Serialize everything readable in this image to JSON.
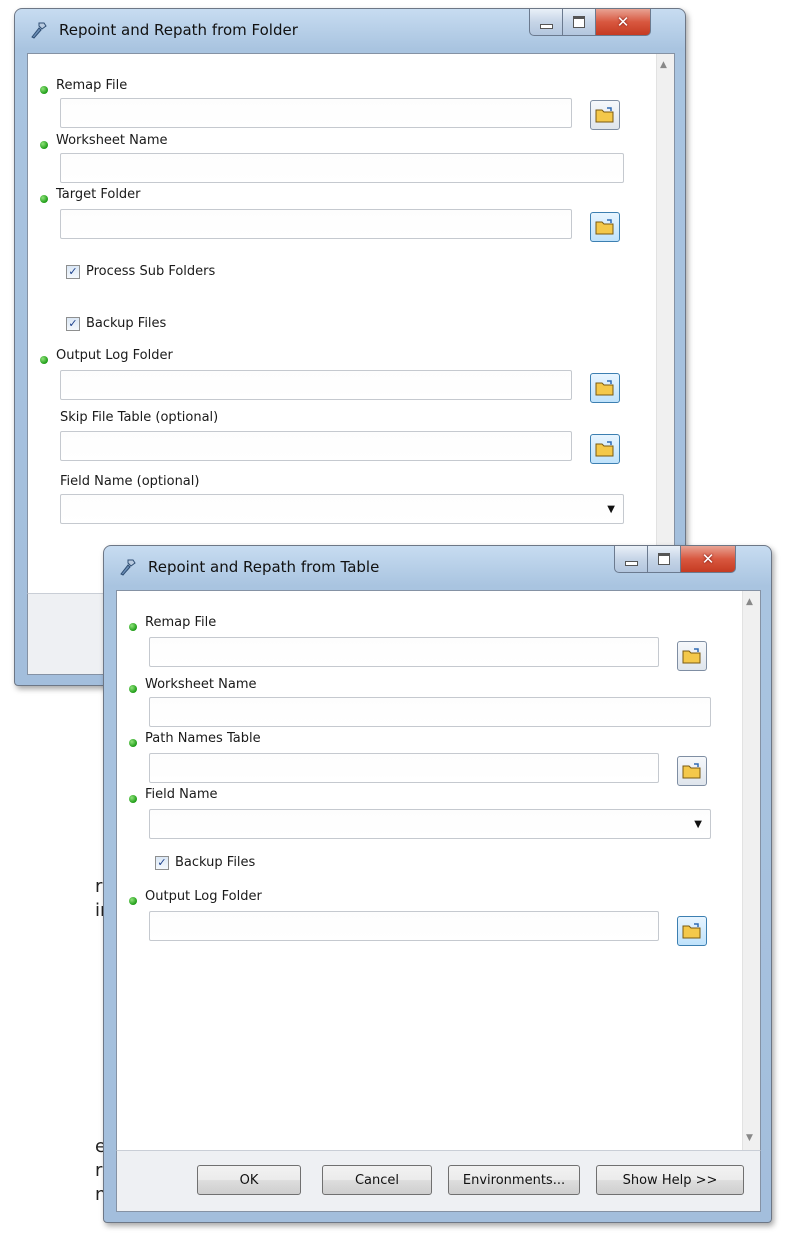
{
  "background_text": [
    "reate",
    "inal",
    "e,",
    "rrors",
    "nks"
  ],
  "folder_window": {
    "title": "Repoint and Repath from Folder",
    "fields": {
      "remap_file": {
        "label": "Remap File",
        "value": ""
      },
      "worksheet_name": {
        "label": "Worksheet Name",
        "value": ""
      },
      "target_folder": {
        "label": "Target Folder",
        "value": ""
      },
      "output_log_folder": {
        "label": "Output Log Folder",
        "value": ""
      },
      "skip_file_table": {
        "label": "Skip File Table (optional)",
        "value": ""
      },
      "field_name": {
        "label": "Field Name (optional)",
        "value": ""
      }
    },
    "checkboxes": {
      "process_sub_folders": {
        "label": "Process Sub Folders",
        "checked": true
      },
      "backup_files": {
        "label": "Backup Files",
        "checked": true
      }
    }
  },
  "table_window": {
    "title": "Repoint and Repath from Table",
    "fields": {
      "remap_file": {
        "label": "Remap File",
        "value": ""
      },
      "worksheet_name": {
        "label": "Worksheet Name",
        "value": ""
      },
      "path_names_table": {
        "label": "Path Names Table",
        "value": ""
      },
      "field_name": {
        "label": "Field Name",
        "value": ""
      },
      "output_log_folder": {
        "label": "Output Log Folder",
        "value": ""
      }
    },
    "checkboxes": {
      "backup_files": {
        "label": "Backup Files",
        "checked": true
      }
    },
    "buttons": {
      "ok": "OK",
      "cancel": "Cancel",
      "environments": "Environments...",
      "show_help": "Show Help >>"
    }
  },
  "check_glyph": "✓",
  "colors": {
    "required_dot": "#1d9c16",
    "close_button": "#c53b22",
    "title_gradient": "#c7dcf1"
  },
  "icons": [
    "app-tool-icon",
    "folder-browse-icon",
    "minimize-icon",
    "maximize-icon",
    "close-icon",
    "dropdown-arrow-icon"
  ]
}
